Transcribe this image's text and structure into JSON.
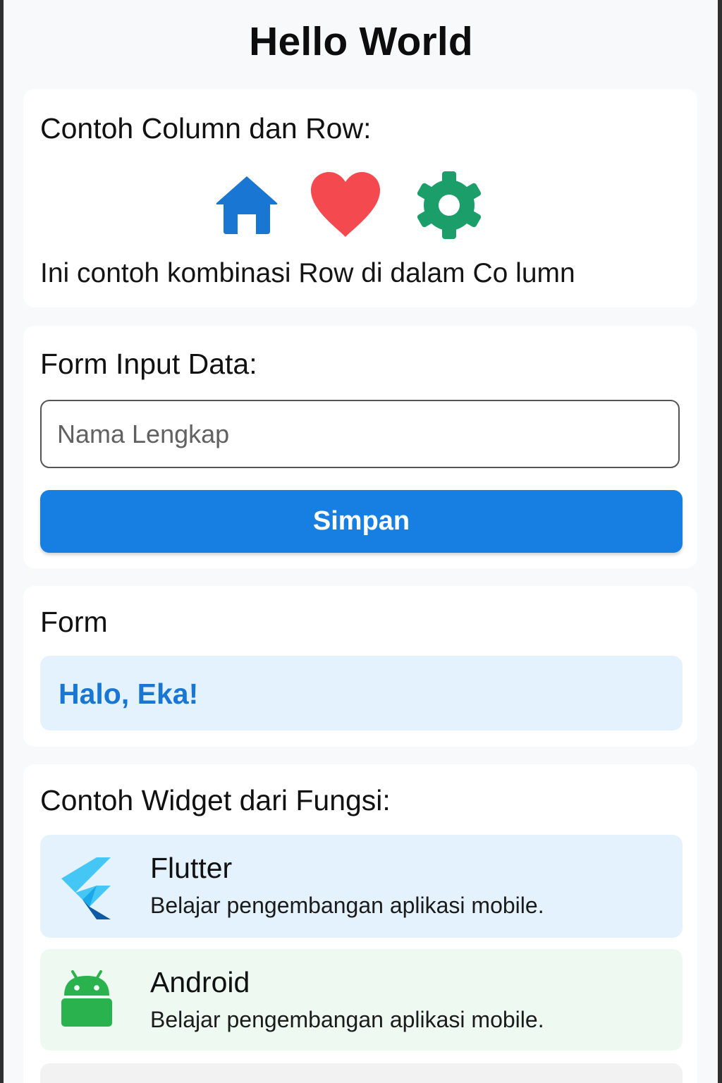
{
  "appbar": {
    "title": "Hello World"
  },
  "column_row_card": {
    "title": "Contoh Column dan Row:",
    "icons": [
      {
        "name": "home-icon",
        "color": "#1976d2"
      },
      {
        "name": "heart-icon",
        "color": "#f44a4f"
      },
      {
        "name": "gear-icon",
        "color": "#1b9e6a"
      }
    ],
    "description": "Ini contoh kombinasi Row di dalam Co lumn"
  },
  "form_card": {
    "title": "Form Input Data:",
    "input_placeholder": "Nama Lengkap",
    "input_value": "",
    "save_label": "Simpan",
    "accent_color": "#177fe1"
  },
  "greeting_card": {
    "title": "Form",
    "greeting": "Halo, Eka!",
    "greeting_color": "#1976d2"
  },
  "widget_card": {
    "title": "Contoh Widget dari Fungsi:",
    "items": [
      {
        "title": "Flutter",
        "subtitle": "Belajar pengembangan aplikasi mobile.",
        "icon": "flutter-logo-icon",
        "background": "#e4f2fd"
      },
      {
        "title": "Android",
        "subtitle": "Belajar pengembangan aplikasi mobile.",
        "icon": "android-logo-icon",
        "background": "#eefaf1"
      }
    ]
  }
}
